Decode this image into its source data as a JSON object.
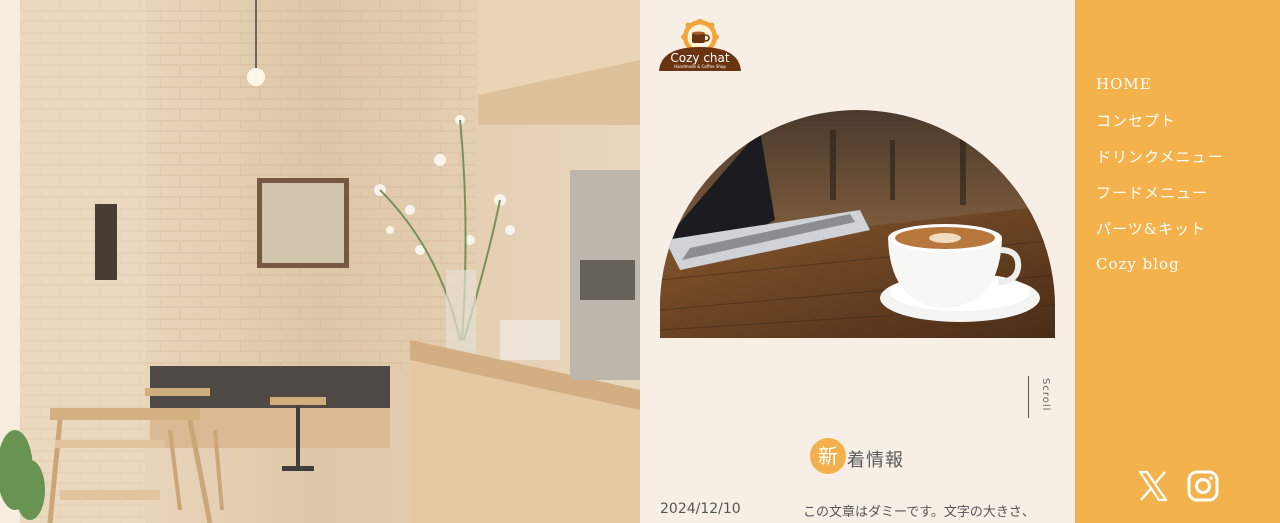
{
  "logo": {
    "name": "Cozy chat",
    "tagline": "Handmade & Coffee Shop"
  },
  "scroll": {
    "label": "Scroll"
  },
  "news": {
    "badge": "新",
    "title_rest": "着情報",
    "items": [
      {
        "date": "2024/12/10",
        "text": "この文章はダミーです。文字の大きさ、"
      }
    ]
  },
  "nav": {
    "items": [
      {
        "label": "HOME"
      },
      {
        "label": "コンセプト"
      },
      {
        "label": "ドリンクメニュー"
      },
      {
        "label": "フードメニュー"
      },
      {
        "label": "パーツ&キット"
      },
      {
        "label": "Cozy blog"
      }
    ],
    "social": [
      {
        "icon": "x-icon"
      },
      {
        "icon": "instagram-icon"
      }
    ]
  },
  "colors": {
    "accent": "#f4b24d",
    "background": "#f7efe6",
    "logo_brown": "#6b3410"
  }
}
